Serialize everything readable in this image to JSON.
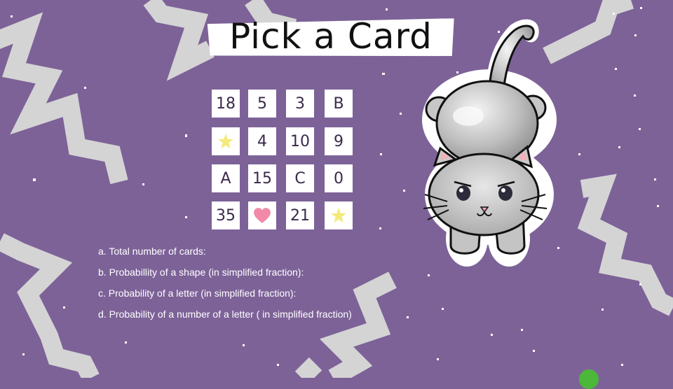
{
  "title": "Pick a Card",
  "cards": [
    {
      "label": "18"
    },
    {
      "label": "5"
    },
    {
      "label": "3"
    },
    {
      "label": "B"
    },
    {
      "icon": "star-icon"
    },
    {
      "label": "4"
    },
    {
      "label": "10"
    },
    {
      "label": "9"
    },
    {
      "label": "A"
    },
    {
      "label": "15"
    },
    {
      "label": "C"
    },
    {
      "label": "0"
    },
    {
      "label": "35"
    },
    {
      "icon": "heart-icon"
    },
    {
      "label": "21"
    },
    {
      "icon": "star-icon"
    }
  ],
  "questions": [
    "a. Total number of cards:",
    "b. Probabillity of a shape (in simplified fraction):",
    "c. Probability of a letter (in simplified fraction):",
    "d. Probability of a number of a letter ( in simplified fraction)"
  ],
  "colors": {
    "background": "#7d6298",
    "zigzag": "#d4d4d4",
    "star": "#f3ea7a",
    "heart": "#f08aa8"
  }
}
